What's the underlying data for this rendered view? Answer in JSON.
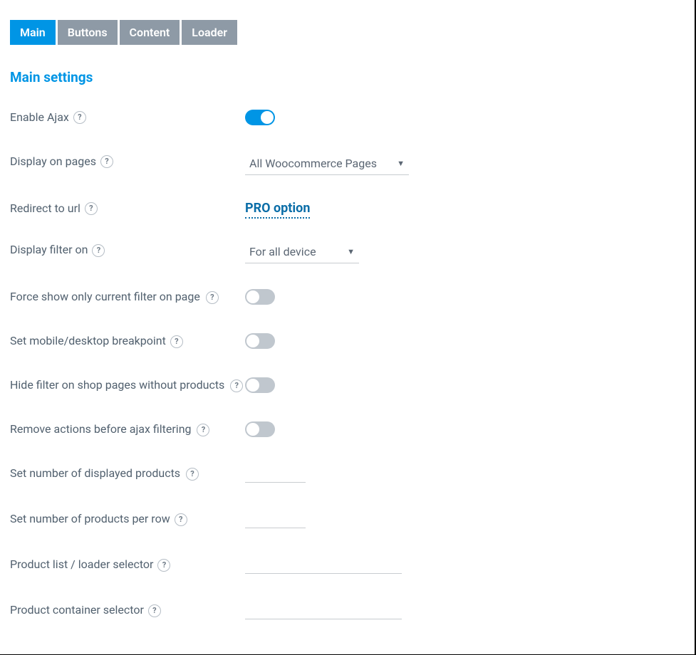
{
  "tabs": [
    {
      "label": "Main",
      "active": true
    },
    {
      "label": "Buttons",
      "active": false
    },
    {
      "label": "Content",
      "active": false
    },
    {
      "label": "Loader",
      "active": false
    }
  ],
  "section_title": "Main settings",
  "help_glyph": "?",
  "caret_glyph": "▼",
  "rows": {
    "enable_ajax": {
      "label": "Enable Ajax"
    },
    "display_on_pages": {
      "label": "Display on pages",
      "value": "All Woocommerce Pages"
    },
    "redirect_to_url": {
      "label": "Redirect to url",
      "pro_label": "PRO option"
    },
    "display_filter_on": {
      "label": "Display filter on",
      "value": "For all device"
    },
    "force_show_current": {
      "label": "Force show only current filter on page"
    },
    "set_breakpoint": {
      "label": "Set mobile/desktop breakpoint"
    },
    "hide_without_products": {
      "label": "Hide filter on shop pages without products"
    },
    "remove_actions": {
      "label": "Remove actions before ajax filtering"
    },
    "num_displayed_products": {
      "label": "Set number of displayed products"
    },
    "products_per_row": {
      "label": "Set number of products per row"
    },
    "product_list_selector": {
      "label": "Product list / loader selector"
    },
    "product_container_sel": {
      "label": "Product container selector"
    }
  }
}
